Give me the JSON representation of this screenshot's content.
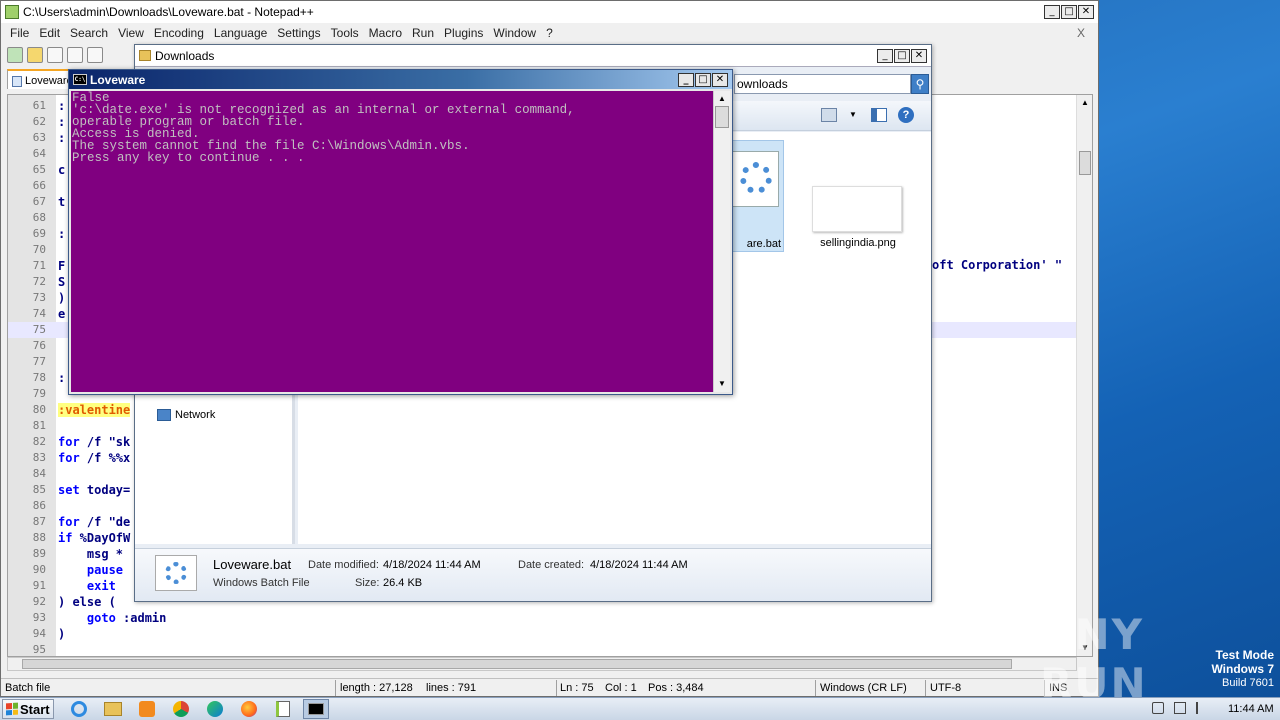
{
  "notepad": {
    "title": "C:\\Users\\admin\\Downloads\\Loveware.bat - Notepad++",
    "menu": [
      "File",
      "Edit",
      "Search",
      "View",
      "Encoding",
      "Language",
      "Settings",
      "Tools",
      "Macro",
      "Run",
      "Plugins",
      "Window",
      "?"
    ],
    "close_x": "X",
    "tab_label": "Loveware",
    "lines": [
      {
        "n": "61",
        "code": ":"
      },
      {
        "n": "62",
        "code": ":"
      },
      {
        "n": "63",
        "code": ":"
      },
      {
        "n": "64",
        "code": ""
      },
      {
        "n": "65",
        "code": "c"
      },
      {
        "n": "66",
        "code": ""
      },
      {
        "n": "67",
        "code": "t"
      },
      {
        "n": "68",
        "code": ""
      },
      {
        "n": "69",
        "code": ":"
      },
      {
        "n": "70",
        "code": ""
      },
      {
        "n": "71",
        "code": "F"
      },
      {
        "n": "72",
        "code": "S"
      },
      {
        "n": "73",
        "code": ")"
      },
      {
        "n": "74",
        "code": "e"
      },
      {
        "n": "75",
        "code": ""
      },
      {
        "n": "76",
        "code": ""
      },
      {
        "n": "77",
        "code": ""
      },
      {
        "n": "78",
        "code": ":"
      },
      {
        "n": "79",
        "code": ""
      },
      {
        "n": "80",
        "code": ":valentine"
      },
      {
        "n": "81",
        "code": ""
      },
      {
        "n": "82",
        "code": "for /f \"sk"
      },
      {
        "n": "83",
        "code": "for /f %%x"
      },
      {
        "n": "84",
        "code": ""
      },
      {
        "n": "85",
        "code": "set today="
      },
      {
        "n": "86",
        "code": ""
      },
      {
        "n": "87",
        "code": "for /f \"de"
      },
      {
        "n": "88",
        "code": "if %DayOfW"
      },
      {
        "n": "89",
        "code": "    msg *"
      },
      {
        "n": "90",
        "code": "    pause"
      },
      {
        "n": "91",
        "code": "    exit"
      },
      {
        "n": "92",
        "code": ") else ("
      },
      {
        "n": "93",
        "code": "    goto :admin"
      },
      {
        "n": "94",
        "code": ")"
      },
      {
        "n": "95",
        "code": ""
      }
    ],
    "right_fragment": "oft Corporation' \"",
    "status": {
      "type": "Batch file",
      "length": "length : 27,128",
      "lines": "lines : 791",
      "ln": "Ln : 75",
      "col": "Col : 1",
      "pos": "Pos : 3,484",
      "eol": "Windows (CR LF)",
      "encoding": "UTF-8",
      "mode": "INS"
    }
  },
  "explorer": {
    "title": "Downloads",
    "search_text": "ownloads",
    "nav_network": "Network",
    "files": [
      {
        "name": "are.bat"
      },
      {
        "name": "sellingindia.png"
      }
    ],
    "details": {
      "filename": "Loveware.bat",
      "filetype": "Windows Batch File",
      "modified_label": "Date modified:",
      "modified": "4/18/2024 11:44 AM",
      "created_label": "Date created:",
      "created": "4/18/2024 11:44 AM",
      "size_label": "Size:",
      "size": "26.4 KB"
    }
  },
  "console": {
    "title": "Loveware",
    "output": "False\n'c:\\date.exe' is not recognized as an internal or external command,\noperable program or batch file.\nAccess is denied.\nThe system cannot find the file C:\\Windows\\Admin.vbs.\nPress any key to continue . . ."
  },
  "taskbar": {
    "start": "Start",
    "clock": "11:44 AM",
    "apps": [
      "ie-icon",
      "explorer-icon",
      "media-player-icon",
      "chrome-icon",
      "edge-icon",
      "firefox-icon",
      "notepadpp-icon",
      "cmd-icon"
    ]
  },
  "desktop": {
    "watermark": "ANY RUN",
    "testmode_line1": "Test Mode",
    "testmode_line2": "Windows 7",
    "testmode_line3": "Build 7601"
  },
  "colors": {
    "console_bg": "#800080",
    "console_fg": "#c0c0c0",
    "desktop": "#2a7fd0",
    "label_highlight": "#ffff80"
  }
}
